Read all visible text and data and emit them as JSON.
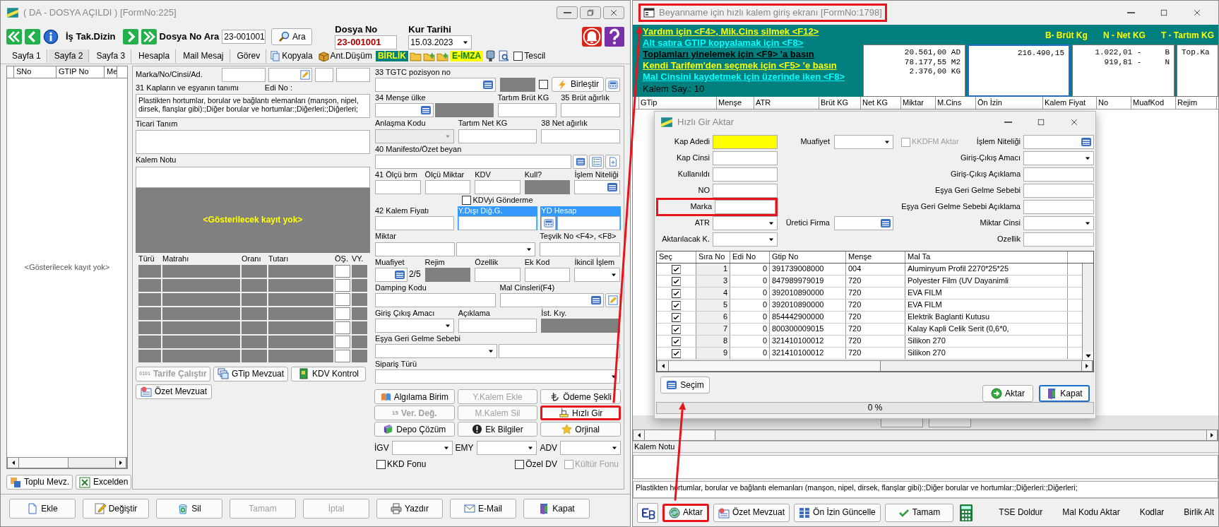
{
  "left_window": {
    "title": "( DA  - DOSYA AÇILDI ) [FormNo:225]",
    "header": {
      "nav_label": "İş Tak.Dizin",
      "search_label": "Dosya No Ara",
      "search_value": "23-001001",
      "search_button": "Ara",
      "file_label": "Dosya No",
      "file_value": "23-001001",
      "rate_label": "Kur Tarihi",
      "rate_value": "15.03.2023"
    },
    "tabs": [
      {
        "kind": "tab",
        "label": "Sayfa 1",
        "selected": false
      },
      {
        "kind": "tab",
        "label": "Sayfa 2",
        "selected": true
      },
      {
        "kind": "tab",
        "label": "Sayfa 3",
        "selected": false
      },
      {
        "kind": "menu",
        "label": "Hesapla"
      },
      {
        "kind": "menu",
        "label": "Mail Mesaj"
      },
      {
        "kind": "menu",
        "label": "Görev"
      },
      {
        "kind": "tool",
        "label": "Kopyala"
      },
      {
        "kind": "tool",
        "label": "Ant.Düşüm"
      },
      {
        "kind": "badge",
        "label": "BİRLİK",
        "color": "#008080"
      },
      {
        "kind": "icon"
      },
      {
        "kind": "icon"
      },
      {
        "kind": "icon"
      },
      {
        "kind": "badge",
        "label": "E-İMZA",
        "color": "#ffff00"
      },
      {
        "kind": "icon"
      },
      {
        "kind": "icon"
      },
      {
        "kind": "check",
        "label": "Tescil",
        "checked": false
      }
    ],
    "list": {
      "columns": [
        "SNo",
        "GTIP No",
        "Me"
      ],
      "empty": "<Gösterilecek kayıt yok>",
      "buttons": [
        "Toplu Mevz.",
        "Excelden"
      ]
    },
    "item": {
      "marka_label": "Marka/No/Cinsi/Ad.",
      "description_label": "31 Kapların ve eşyanın tanımı",
      "edi_label": "Edi No :",
      "description": "Plastikten hortumlar, borular ve bağlantı elemanları (manşon, nipel, dirsek, flanşlar gibi):;Diğer borular ve hortumlar:;Diğerleri:;Diğerleri;",
      "trade_label": "Ticari Tanım",
      "note_label": "Kalem Notu",
      "empty_grid": "<Gösterilecek kayıt yok>",
      "tax_columns": [
        "Türü",
        "Matrahı",
        "Oranı",
        "Tutarı",
        "ÖŞ.",
        "VY."
      ],
      "buttons": [
        {
          "label": "Tarife Çalıştır",
          "prefix": "0101",
          "disabled": true
        },
        {
          "label": "GTip Mevzuat",
          "disabled": false
        },
        {
          "label": "KDV Kontrol",
          "disabled": false
        },
        {
          "label": "Özet Mevzuat",
          "disabled": false
        }
      ]
    },
    "fields": [
      [
        {
          "label": "33 TGTC pozisyon no",
          "controls": [
            {
              "kind": "lookup"
            }
          ]
        },
        {
          "controls": [
            {
              "kind": "grey"
            },
            {
              "kind": "check",
              "checked": false
            },
            {
              "kind": "button",
              "text": "Birleştir"
            },
            {
              "kind": "calc"
            }
          ]
        }
      ],
      [
        {
          "label": "34 Menşe ülke",
          "controls": [
            {
              "kind": "lookup"
            },
            {
              "kind": "grey"
            }
          ]
        },
        {
          "label": "Tartım Brüt KG",
          "controls": [
            {
              "kind": "field"
            }
          ]
        },
        {
          "label": "35 Brüt ağırlık",
          "controls": [
            {
              "kind": "field"
            }
          ]
        }
      ],
      [
        {
          "label": "Anlaşma Kodu",
          "controls": [
            {
              "kind": "select",
              "disabled": true
            }
          ]
        },
        {
          "label": "Tartım Net KG",
          "controls": [
            {
              "kind": "field"
            }
          ]
        },
        {
          "label": "38 Net ağırlık",
          "controls": [
            {
              "kind": "field"
            }
          ]
        }
      ],
      [
        {
          "label": "40 Manifesto/Özet beyan",
          "controls": [
            {
              "kind": "field"
            },
            {
              "kind": "list"
            },
            {
              "kind": "bullets"
            },
            {
              "kind": "add"
            }
          ]
        }
      ],
      [
        {
          "label": "41 Ölçü brm",
          "controls": [
            {
              "kind": "field"
            }
          ]
        },
        {
          "label": "Ölçü Miktar",
          "controls": [
            {
              "kind": "field"
            }
          ]
        },
        {
          "label": "KDV",
          "controls": [
            {
              "kind": "field"
            }
          ]
        },
        {
          "label": "Kull?",
          "controls": [
            {
              "kind": "grey"
            }
          ]
        },
        {
          "label": "İşlem Niteliği",
          "controls": [
            {
              "kind": "lookup"
            }
          ]
        }
      ],
      [
        {
          "controls": [
            {
              "kind": "check",
              "checked": false,
              "text": "KDVyi Gönderme"
            }
          ]
        }
      ],
      [
        {
          "label": "42 Kalem Fiyatı",
          "controls": [
            {
              "kind": "field"
            }
          ]
        },
        {
          "label": "Y.Dışı Diğ.G.",
          "focused": true,
          "controls": [
            {
              "kind": "field"
            }
          ]
        },
        {
          "label": "YD Hesap",
          "focused": true,
          "controls": [
            {
              "kind": "calc"
            },
            {
              "kind": "field"
            }
          ]
        }
      ],
      [
        {
          "label": "Miktar",
          "controls": [
            {
              "kind": "field"
            },
            {
              "kind": "select"
            }
          ]
        },
        {
          "label": "Teşvik No <F4>, <F8>",
          "controls": [
            {
              "kind": "field"
            }
          ]
        }
      ],
      [
        {
          "label": "Muafiyet",
          "controls": [
            {
              "kind": "lookup"
            },
            {
              "kind": "text",
              "text": "2/5"
            }
          ]
        },
        {
          "label": "Rejim",
          "controls": [
            {
              "kind": "grey"
            }
          ]
        },
        {
          "label": "Özellik",
          "controls": [
            {
              "kind": "field"
            }
          ]
        },
        {
          "label": "Ek Kod",
          "controls": [
            {
              "kind": "field"
            }
          ]
        },
        {
          "label": "İkincil İşlem",
          "controls": [
            {
              "kind": "select"
            }
          ]
        }
      ],
      [
        {
          "label": "Damping Kodu",
          "controls": [
            {
              "kind": "field"
            }
          ]
        },
        {
          "label": "Mal Cinsleri(F4)",
          "controls": [
            {
              "kind": "lookup"
            },
            {
              "kind": "edit"
            }
          ]
        }
      ],
      [
        {
          "label": "Giriş Çıkış Amacı",
          "controls": [
            {
              "kind": "select"
            }
          ]
        },
        {
          "label": "Açıklama",
          "controls": [
            {
              "kind": "field"
            }
          ]
        },
        {
          "label": "İst. Kıy.",
          "controls": [
            {
              "kind": "grey"
            }
          ]
        }
      ],
      [
        {
          "label": "Eşya Geri Gelme Sebebi",
          "controls": [
            {
              "kind": "select"
            },
            {
              "kind": "field"
            }
          ]
        }
      ],
      [
        {
          "label": "Sipariş Türü",
          "controls": [
            {
              "kind": "select"
            }
          ]
        }
      ]
    ],
    "actions": [
      {
        "label": "Algılama Birim",
        "disabled": false,
        "highlighted": false
      },
      {
        "label": "Y.Kalem Ekle",
        "disabled": true,
        "highlighted": false
      },
      {
        "label": "Ödeme Şekli",
        "disabled": false,
        "highlighted": false
      },
      {
        "label": "Ver. Değ.",
        "prefix": "15",
        "disabled": true,
        "highlighted": false
      },
      {
        "label": "M.Kalem Sil",
        "disabled": true,
        "highlighted": false
      },
      {
        "label": "Hızlı Gir",
        "disabled": false,
        "highlighted": true
      },
      {
        "label": "Depo Çözüm",
        "disabled": false,
        "highlighted": false
      },
      {
        "label": "Ek Bilgiler",
        "disabled": false,
        "highlighted": false
      },
      {
        "label": "Orjinal",
        "disabled": false,
        "highlighted": false
      }
    ],
    "taxes": [
      "İGV",
      "EMY",
      "ADV"
    ],
    "flags": [
      {
        "label": "KKD Fonu",
        "checked": false,
        "disabled": false
      },
      {
        "label": "Özel DV",
        "checked": false,
        "disabled": false
      },
      {
        "label": "Kültür Fonu",
        "checked": false,
        "disabled": true
      }
    ],
    "bottom_buttons": [
      {
        "label": "Ekle",
        "disabled": false
      },
      {
        "label": "Değiştir",
        "disabled": false
      },
      {
        "label": "Sil",
        "disabled": false
      },
      {
        "label": "Tamam",
        "disabled": true
      },
      {
        "label": "İptal",
        "disabled": true
      },
      {
        "label": "Yazdır",
        "disabled": false
      },
      {
        "label": "E-Mail",
        "disabled": false
      },
      {
        "label": "Kapat",
        "disabled": false
      }
    ]
  },
  "right_window": {
    "title": "Beyanname için hızlı kalem giriş ekranı [FormNo:1798]",
    "title_highlighted": true,
    "help_lines": [
      {
        "text": "Yardım için <F4>, Mik.Cins silmek <F12>",
        "color": "#ffff00"
      },
      {
        "text": "Alt satıra GTIP kopyalamak için <F8>",
        "color": "#00ffff"
      },
      {
        "text": "Toplamları yinelemek için <F9> 'a basın",
        "color": "#000000"
      },
      {
        "text": "Kendi Tarifem'den seçmek  için <F5> 'e basın",
        "color": "#ffff00"
      },
      {
        "text": "Mal Cinsini kaydetmek için üzerinde iken <F8>",
        "color": "#00ffff"
      }
    ],
    "item_count": "Kalem Say.: 10",
    "legend": [
      "B- Brüt Kg",
      "N - Net KG",
      "T - Tartım KG"
    ],
    "totals": [
      {
        "lines": [
          "20.561,00 AD",
          "78.177,55 M2",
          "2.376,00 KG"
        ],
        "focused": false
      },
      {
        "lines": [
          "216.490,15"
        ],
        "focused": true
      },
      {
        "lines": [
          "1.022,01 -     B",
          "919,81 -     N"
        ],
        "focused": false
      },
      {
        "lines": [
          "Top.Ka"
        ],
        "focused": false
      }
    ],
    "columns": [
      "GTip",
      "Menşe",
      "ATR",
      "Brüt KG",
      "Net KG",
      "Miktar",
      "M.Cins",
      "Ön İzin",
      "Kalem Fiyat",
      "No",
      "MuafKod",
      "Rejim"
    ],
    "note_label": "Kalem Notu",
    "description": "Plastikten hortumlar, borular ve bağlantı elemanları (manşon, nipel, dirsek, flanşlar gibi):;Diğer borular ve hortumlar:;Diğerleri:;Diğerleri;",
    "toolbar": [
      {
        "label": "Aktar",
        "highlighted": true
      },
      {
        "label": "Özet Mevzuat",
        "highlighted": false
      },
      {
        "label": "Ön İzin Güncelle",
        "highlighted": false
      },
      {
        "label": "Tamam",
        "highlighted": false
      }
    ],
    "links": [
      "TSE Doldur",
      "Mal Kodu Aktar",
      "Kodlar",
      "Birlik Alt"
    ]
  },
  "dialog": {
    "title": "Hızlı Gir Aktar",
    "form_rows": [
      {
        "left": {
          "label": "Kap Adedi",
          "kind": "field",
          "focused": true
        },
        "middle": [
          {
            "label": "Muafiyet",
            "kind": "select"
          },
          {
            "label": "KKDFM Aktar",
            "kind": "check",
            "checked": false,
            "disabled": true
          }
        ],
        "right": {
          "label": "İşlem Niteliği",
          "kind": "lookup"
        }
      },
      {
        "left": {
          "label": "Kap Cinsi",
          "kind": "field"
        },
        "right": {
          "label": "Giriş-Çıkış Amacı",
          "kind": "select"
        }
      },
      {
        "left": {
          "label": "Kullanıldı",
          "kind": "field"
        },
        "right": {
          "label": "Giriş-Çıkış Açıklama",
          "kind": "field"
        }
      },
      {
        "left": {
          "label": "NO",
          "kind": "field"
        },
        "right": {
          "label": "Eşya Geri Gelme Sebebi",
          "kind": "field"
        }
      },
      {
        "left": {
          "label": "Marka",
          "kind": "field",
          "highlighted": true
        },
        "right": {
          "label": "Eşya Geri Gelme Sebebi  Açıklama",
          "kind": "field"
        }
      },
      {
        "left": {
          "label": "ATR",
          "kind": "select"
        },
        "middle": [
          {
            "label": "Üretici Firma",
            "kind": "lookup"
          }
        ],
        "right": {
          "label": "Miktar Cinsi",
          "kind": "select"
        }
      },
      {
        "left": {
          "label": "Aktarılacak K.",
          "kind": "select"
        },
        "right": {
          "label": "Ozellik",
          "kind": "field"
        }
      }
    ],
    "select_column": "Seç",
    "columns": [
      "Sıra No",
      "Edi No",
      "Gtip No",
      "Menşe",
      "Mal Ta"
    ],
    "rows": [
      {
        "checked": true,
        "cells": [
          "1",
          "0",
          "391739008000",
          "004",
          "Aluminyum Profil 2270*25*25"
        ]
      },
      {
        "checked": true,
        "cells": [
          "3",
          "0",
          "847989979019",
          "720",
          "Polyester Film (UV Dayanimli"
        ]
      },
      {
        "checked": true,
        "cells": [
          "4",
          "0",
          "392010890000",
          "720",
          "EVA FILM"
        ]
      },
      {
        "checked": true,
        "cells": [
          "5",
          "0",
          "392010890000",
          "720",
          "EVA FILM"
        ]
      },
      {
        "checked": true,
        "cells": [
          "6",
          "0",
          "854442900000",
          "720",
          "Elektrik Baglanti Kutusu"
        ]
      },
      {
        "checked": true,
        "cells": [
          "7",
          "0",
          "800300009015",
          "720",
          "Kalay Kapli Celik Serit (0,6*0,"
        ]
      },
      {
        "checked": true,
        "cells": [
          "8",
          "0",
          "321410100012",
          "720",
          "Silikon 270"
        ]
      },
      {
        "checked": true,
        "cells": [
          "9",
          "0",
          "321410100012",
          "720",
          "Silikon 270"
        ]
      }
    ],
    "buttons": [
      {
        "label": "Seçim",
        "default": false
      },
      {
        "label": "Aktar",
        "default": false
      },
      {
        "label": "Kapat",
        "default": true
      }
    ],
    "progress": {
      "level": 0,
      "text": "0 %"
    }
  }
}
